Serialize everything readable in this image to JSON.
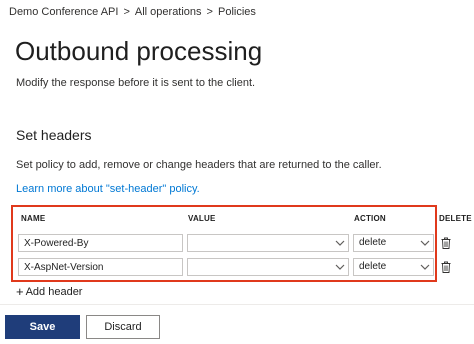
{
  "breadcrumb": {
    "items": [
      "Demo Conference API",
      "All operations",
      "Policies"
    ],
    "separator": ">"
  },
  "page": {
    "title": "Outbound processing",
    "description": "Modify the response before it is sent to the client."
  },
  "set_headers": {
    "title": "Set headers",
    "description": "Set policy to add, remove or change headers that are returned to the caller.",
    "learn_more": "Learn more about \"set-header\" policy."
  },
  "table": {
    "columns": {
      "name": "NAME",
      "value": "VALUE",
      "action": "ACTION",
      "delete": "DELETE"
    },
    "rows": [
      {
        "name": "X-Powered-By",
        "value": "",
        "action": "delete",
        "delete_icon": "trash-icon"
      },
      {
        "name": "X-AspNet-Version",
        "value": "",
        "action": "delete",
        "delete_icon": "trash-icon"
      }
    ]
  },
  "add_header": {
    "label": "Add header",
    "icon": "plus-icon"
  },
  "buttons": {
    "save": "Save",
    "discard": "Discard"
  },
  "colors": {
    "accent_link": "#0078d4",
    "primary_button": "#1f3d7a",
    "highlight_border": "#e0391c"
  }
}
